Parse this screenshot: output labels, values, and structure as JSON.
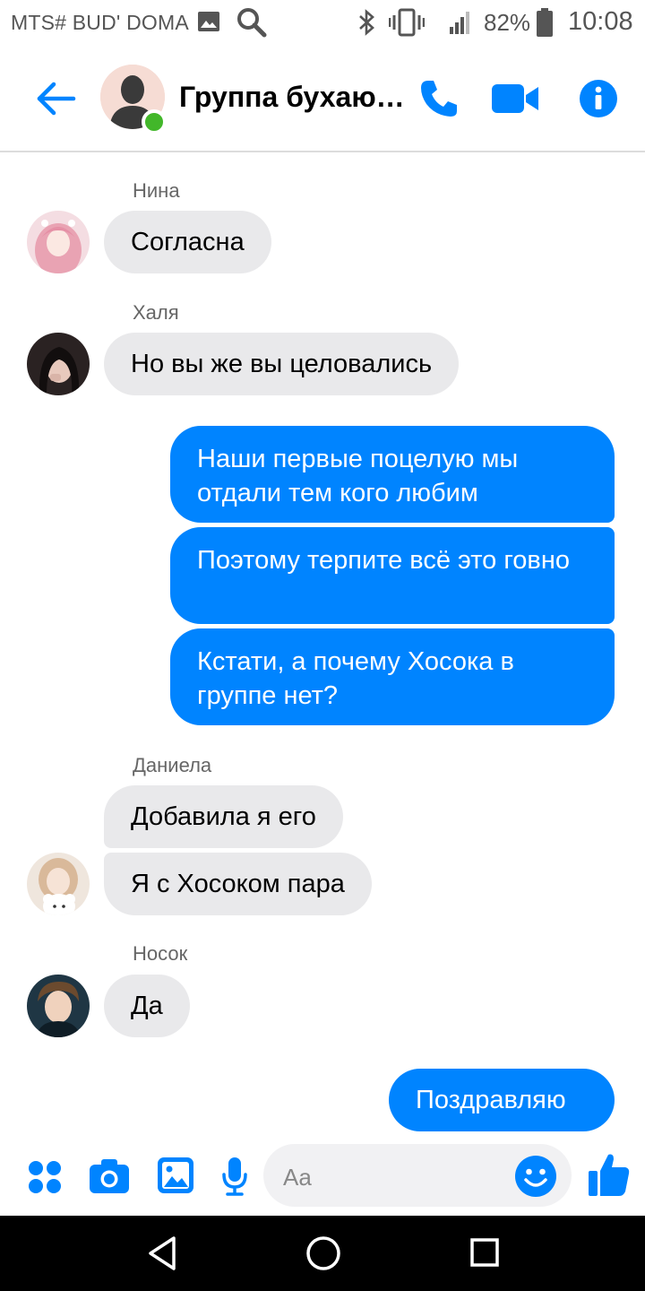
{
  "status_bar": {
    "carrier": "MTS# BUD' DOMA",
    "battery": "82%",
    "time": "10:08"
  },
  "header": {
    "title": "Группа бухаю…"
  },
  "messages": [
    {
      "sender": "Нина",
      "text": "Согласна"
    },
    {
      "sender": "Халя",
      "text": "Но вы же вы целовались"
    },
    {
      "text": "Наши первые поцелую мы отдали тем кого любим"
    },
    {
      "text": "Поэтому терпите всё это говно"
    },
    {
      "text": "Кстати, а почему Хосока в группе нет?"
    },
    {
      "sender": "Даниела",
      "text": "Добавила я его"
    },
    {
      "text": "Я с Хосоком пара"
    },
    {
      "sender": "Носок",
      "text": "Да"
    },
    {
      "text": "Поздравляю"
    }
  ],
  "composer": {
    "placeholder": "Aa"
  },
  "colors": {
    "accent": "#0084ff",
    "incoming_bubble": "#e9e9eb",
    "online": "#42b72a"
  },
  "icons": [
    "back-arrow-icon",
    "phone-icon",
    "video-camera-icon",
    "info-icon",
    "apps-icon",
    "camera-icon",
    "gallery-icon",
    "microphone-icon",
    "emoji-icon",
    "thumbs-up-icon"
  ]
}
